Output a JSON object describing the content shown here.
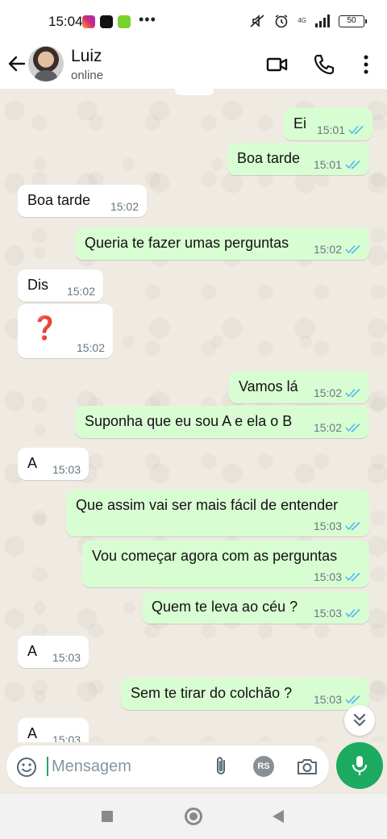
{
  "status_bar": {
    "time": "15:04",
    "network": "4G",
    "battery": "50"
  },
  "header": {
    "contact_name": "Luiz",
    "contact_status": "online"
  },
  "messages": [
    {
      "dir": "out",
      "text": "Ei",
      "time": "15:01"
    },
    {
      "dir": "out",
      "text": "Boa tarde",
      "time": "15:01"
    },
    {
      "dir": "in",
      "text": "Boa tarde",
      "time": "15:02"
    },
    {
      "dir": "out",
      "text": "Queria te fazer umas perguntas",
      "time": "15:02"
    },
    {
      "dir": "in",
      "text": "Dis",
      "time": "15:02"
    },
    {
      "dir": "in",
      "text": "❓",
      "time": "15:02"
    },
    {
      "dir": "out",
      "text": "Vamos lá",
      "time": "15:02"
    },
    {
      "dir": "out",
      "text": "Suponha que eu sou A e ela o B",
      "time": "15:02"
    },
    {
      "dir": "in",
      "text": "A",
      "time": "15:03"
    },
    {
      "dir": "out",
      "text": "Que assim vai ser mais fácil de entender",
      "time": "15:03"
    },
    {
      "dir": "out",
      "text": "Vou começar agora com as perguntas",
      "time": "15:03"
    },
    {
      "dir": "out",
      "text": "Quem te leva ao céu ?",
      "time": "15:03"
    },
    {
      "dir": "in",
      "text": "A",
      "time": "15:03"
    },
    {
      "dir": "out",
      "text": "Sem te tirar do colchão ?",
      "time": "15:03"
    },
    {
      "dir": "in",
      "text": "A",
      "time": "15:03"
    }
  ],
  "composer": {
    "placeholder": "Mensagem",
    "rs_label": "RS"
  },
  "colors": {
    "outgoing_bubble": "#d9fdd3",
    "incoming_bubble": "#ffffff",
    "chat_bg": "#efeae2",
    "accent": "#1daa61",
    "read_tick": "#53bdeb"
  }
}
